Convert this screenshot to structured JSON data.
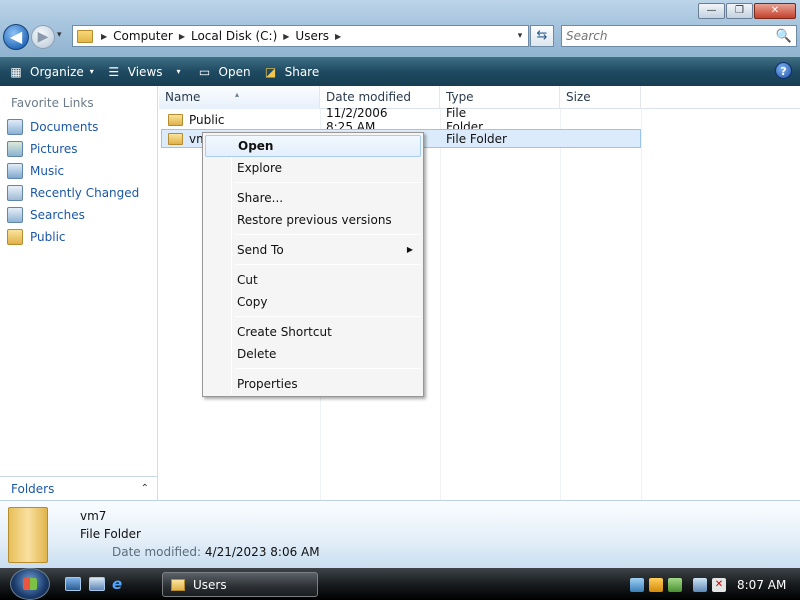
{
  "window": {
    "minimize": "—",
    "maximize": "❐",
    "close": "✕"
  },
  "nav": {
    "back": "◀",
    "forward": "▶",
    "dropdown": "▾"
  },
  "address": {
    "crumbs": [
      "Computer",
      "Local Disk (C:)",
      "Users"
    ],
    "separator": "▶",
    "dropdown": "▾",
    "refresh": "⇆"
  },
  "search": {
    "placeholder": "Search",
    "icon": "🔍"
  },
  "toolbar": {
    "organize_label": "Organize",
    "views_label": "Views",
    "open_label": "Open",
    "share_label": "Share",
    "caret": "▾",
    "help": "?"
  },
  "sidebar": {
    "title": "Favorite Links",
    "items": [
      {
        "label": "Documents",
        "icon": "documents-icon"
      },
      {
        "label": "Pictures",
        "icon": "pictures-icon"
      },
      {
        "label": "Music",
        "icon": "music-icon"
      },
      {
        "label": "Recently Changed",
        "icon": "recent-icon"
      },
      {
        "label": "Searches",
        "icon": "searches-icon"
      },
      {
        "label": "Public",
        "icon": "folder-icon"
      }
    ],
    "folders_label": "Folders",
    "folders_chevron": "⌃"
  },
  "filelist": {
    "columns": [
      "Name",
      "Date modified",
      "Type",
      "Size"
    ],
    "sort_arrow": "▴",
    "rows": [
      {
        "name": "Public",
        "date": "11/2/2006 8:25 AM",
        "type": "File Folder"
      },
      {
        "name": "vm",
        "date": "",
        "type": "File Folder"
      }
    ]
  },
  "context_menu": {
    "items": [
      "Open",
      "Explore",
      "Share...",
      "Restore previous versions",
      "Send To",
      "Cut",
      "Copy",
      "Create Shortcut",
      "Delete",
      "Properties"
    ],
    "submenu_arrow": "▶"
  },
  "details": {
    "name": "vm7",
    "type": "File Folder",
    "modified_label": "Date modified:",
    "modified_value": "4/21/2023 8:06 AM"
  },
  "taskbar": {
    "task_label": "Users",
    "clock": "8:07 AM",
    "ie_glyph": "e"
  },
  "colors": {
    "toolbar": "#1f4a61",
    "link": "#1b58a8",
    "selection": "#dcebfb"
  }
}
